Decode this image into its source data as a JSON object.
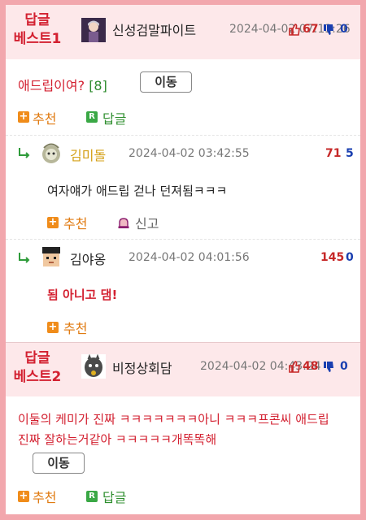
{
  "best1": {
    "badge_line1": "답글",
    "badge_line2": "베스트1",
    "author": "신성검말파이트",
    "date": "2024-04-02 07:13:26",
    "upvotes": "67",
    "downvotes": "0",
    "message": "애드립이여?",
    "reply_count": "[8]",
    "move_label": "이동",
    "recommend_label": "추천",
    "reply_label": "답글"
  },
  "replies": [
    {
      "author": "김미돌",
      "date": "2024-04-02 03:42:55",
      "upvotes": "71",
      "downvotes": "5",
      "text": "여자얘가 애드립 걷나 던져됨ㅋㅋㅋ",
      "recommend_label": "추천",
      "report_label": "신고"
    },
    {
      "author": "김야옹",
      "date": "2024-04-02 04:01:56",
      "upvotes": "145",
      "downvotes": "0",
      "text": "됨 아니고 댐!",
      "recommend_label": "추천"
    }
  ],
  "best2": {
    "badge_line1": "답글",
    "badge_line2": "베스트2",
    "author": "비정상회담",
    "date": "2024-04-02 04:43:24",
    "upvotes": "48",
    "downvotes": "0",
    "message": "이둘의 케미가 진짜 ㅋㅋㅋㅋㅋㅋㅋ아니 ㅋㅋㅋ프콘씨 애드립 진짜 잘하는거같아 ㅋㅋㅋㅋㅋ개똑똑해",
    "move_label": "이동",
    "recommend_label": "추천",
    "reply_label": "답글"
  },
  "colors": {
    "frame": "#f2a7ad",
    "best_bg": "#fde8ea",
    "accent_red": "#d32030",
    "up_red": "#c62828",
    "down_blue": "#1a3fb0",
    "recommend_orange": "#f08c1a",
    "reply_green": "#3aa845"
  }
}
